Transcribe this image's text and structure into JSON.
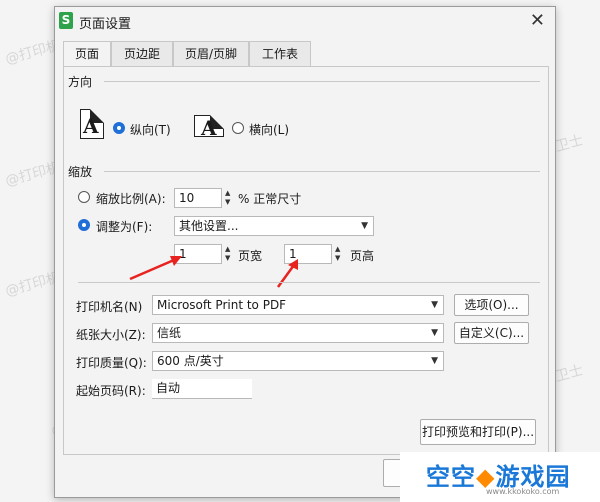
{
  "dialog": {
    "app_icon": "S",
    "title": "页面设置",
    "close_glyph": "✕"
  },
  "tabs": [
    "页面",
    "页边距",
    "页眉/页脚",
    "工作表"
  ],
  "orientation": {
    "section_label": "方向",
    "portrait_letter": "A",
    "portrait_label": "纵向(T)",
    "landscape_letter": "A",
    "landscape_label": "横向(L)",
    "selected": "portrait"
  },
  "scaling": {
    "section_label": "缩放",
    "scale_label": "缩放比例(A):",
    "scale_value": "10",
    "scale_suffix": "% 正常尺寸",
    "fit_label": "调整为(F):",
    "fit_select": "其他设置...",
    "pages_wide_value": "1",
    "pages_wide_label": "页宽",
    "pages_tall_value": "1",
    "pages_tall_label": "页高",
    "selected": "fit"
  },
  "printer": {
    "name_label": "打印机名(N)",
    "name_value": "Microsoft Print to PDF",
    "options_button": "选项(O)...",
    "paper_label": "纸张大小(Z):",
    "paper_value": "信纸",
    "custom_button": "自定义(C)...",
    "quality_label": "打印质量(Q):",
    "quality_value": "600 点/英寸",
    "start_page_label": "起始页码(R):",
    "start_page_value": "自动",
    "preview_print_button": "打印预览和打印(P)..."
  },
  "watermark": "@打印机卫士",
  "logo": {
    "text_left": "空空",
    "text_right": "游戏园",
    "subtext": "www.kkokoko.com"
  },
  "colors": {
    "accent": "#1f6fd6",
    "annotation_arrow": "#e8231f",
    "logo_blue": "#1a78d8",
    "logo_orange": "#ff8a00"
  }
}
